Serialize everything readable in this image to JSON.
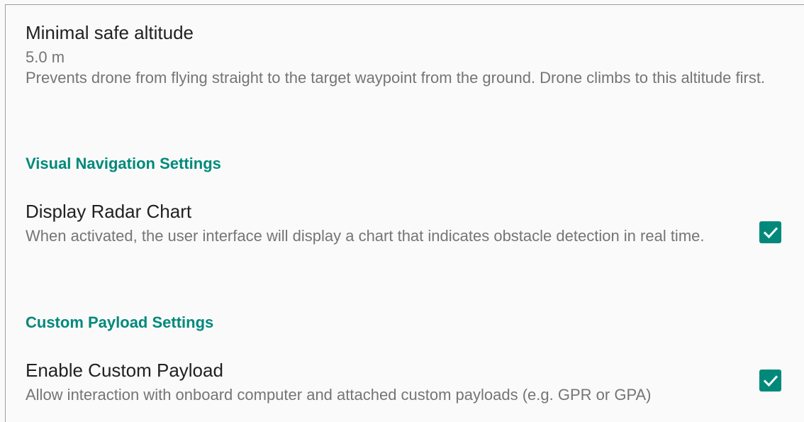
{
  "min_altitude": {
    "title": "Minimal safe altitude",
    "value": "5.0 m",
    "summary": "Prevents drone from flying straight to the target waypoint from the ground. Drone climbs to this altitude first."
  },
  "visual_nav": {
    "header": "Visual Navigation Settings",
    "radar": {
      "title": "Display Radar Chart",
      "summary": "When activated, the user interface will display a chart that indicates obstacle detection in real time.",
      "checked": true
    }
  },
  "custom_payload": {
    "header": "Custom Payload Settings",
    "enable": {
      "title": "Enable Custom Payload",
      "summary": "Allow interaction with onboard computer and attached custom payloads (e.g. GPR or GPA)",
      "checked": true
    }
  },
  "colors": {
    "accent": "#00897b",
    "background": "#fafafa"
  },
  "icons": {
    "checkbox": "check-icon"
  }
}
